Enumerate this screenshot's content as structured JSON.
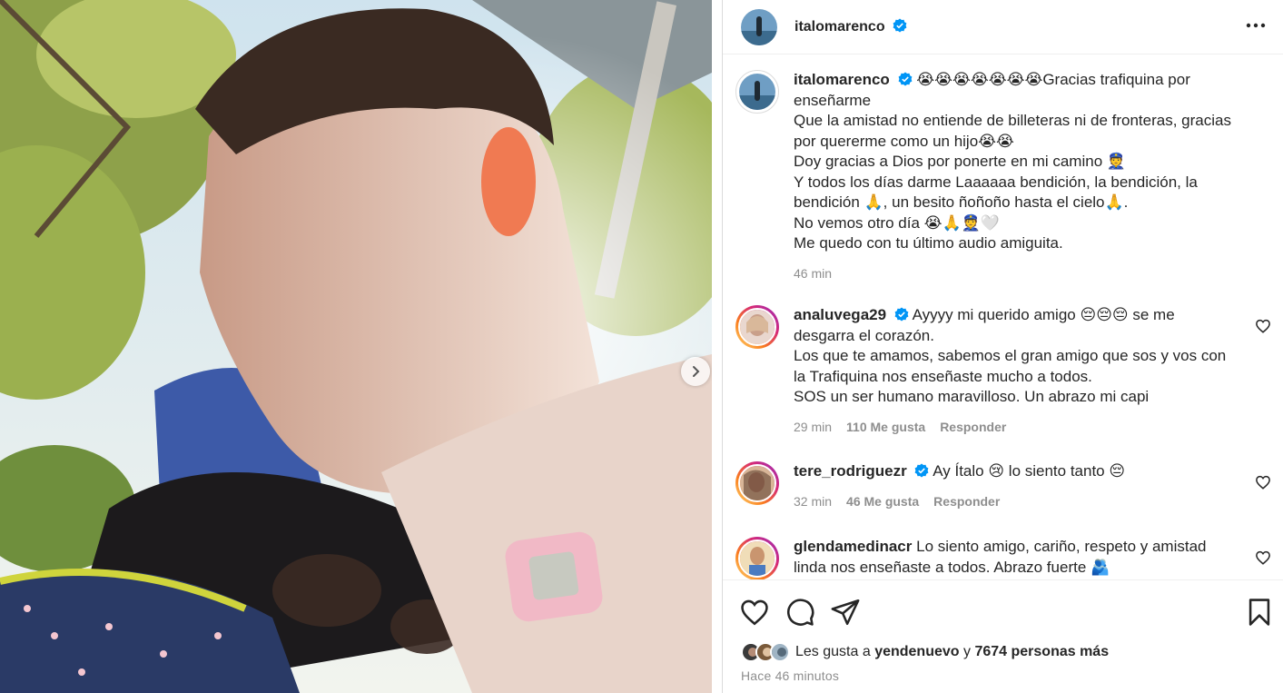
{
  "post": {
    "username": "italomarenco",
    "more_label": "⋯"
  },
  "caption": {
    "username": "italomarenco",
    "lines": [
      "😭😭😭😭😭😭😭Gracias trafiquina por",
      "enseñarme",
      "Que la amistad no entiende de billeteras ni de fronteras, gracias",
      "por quererme como un hijo😭😭",
      "Doy gracias a Dios por ponerte en mi camino 👮",
      "Y todos los días darme Laaaaaa bendición, la bendición, la",
      "bendición 🙏, un besito ñoñoño hasta el cielo🙏.",
      "No vemos otro día 😭🙏👮🤍",
      "Me quedo con tu último audio amiguita."
    ],
    "time": "46 min"
  },
  "comments": [
    {
      "username": "analuvega29",
      "lines": [
        "Ayyyy mi querido amigo 😔😔😔 se me",
        "desgarra el corazón.",
        "Los que te amamos, sabemos el gran amigo que sos y vos con",
        "la Trafiquina nos enseñaste mucho a todos.",
        "SOS un ser humano maravilloso. Un abrazo mi capi"
      ],
      "time": "29 min",
      "likes": "110 Me gusta",
      "reply": "Responder"
    },
    {
      "username": "tere_rodriguezr",
      "lines": [
        "Ay Ítalo 😢 lo siento tanto 😔"
      ],
      "time": "32 min",
      "likes": "46 Me gusta",
      "reply": "Responder"
    },
    {
      "username": "glendamedinacr",
      "lines": [
        "Lo siento amigo, cariño, respeto y amistad",
        "linda nos enseñaste a todos. Abrazo fuerte 🫂"
      ]
    }
  ],
  "likes": {
    "prefix": "Les gusta a",
    "user": "yendenuevo",
    "connector": "y",
    "others": "7674 personas más"
  },
  "timestamp": "Hace 46 minutos",
  "icons": [
    "verified-badge-icon",
    "more-options-icon",
    "carousel-next-icon",
    "heart-icon",
    "comment-icon",
    "share-icon",
    "bookmark-icon"
  ],
  "colors": {
    "verified": "#0095f6",
    "text": "#262626",
    "muted": "#8e8e8e"
  }
}
